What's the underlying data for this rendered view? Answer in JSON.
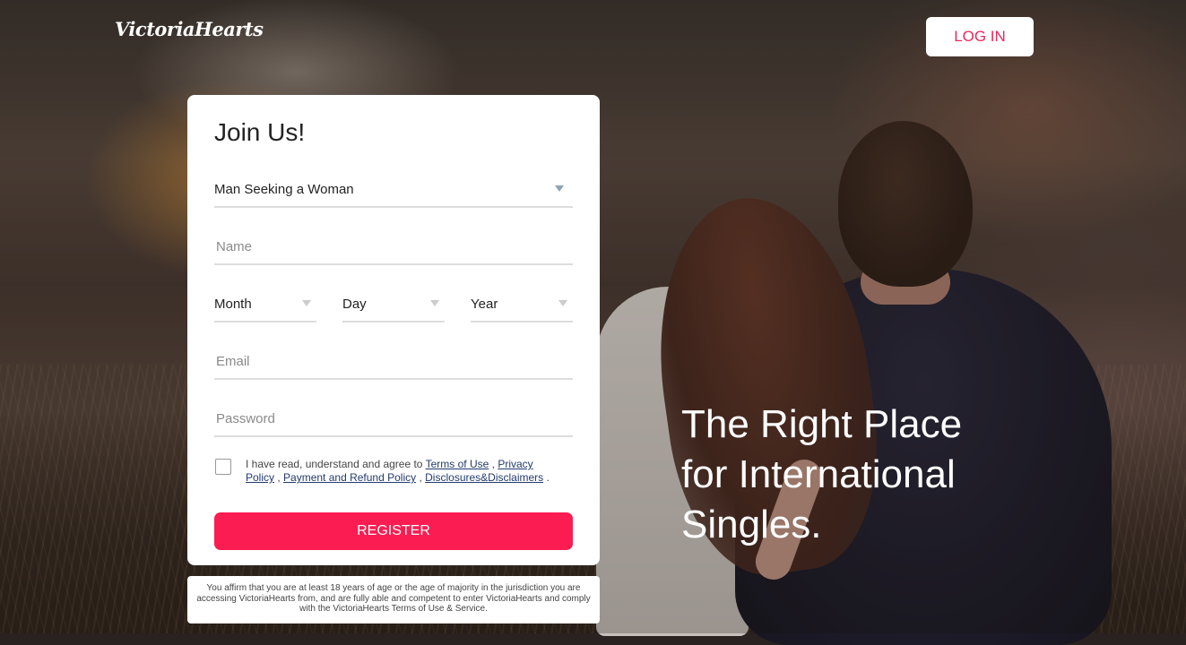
{
  "brand": {
    "logo_text": "VictoriaHearts"
  },
  "header": {
    "login_label": "LOG IN"
  },
  "form": {
    "title": "Join Us!",
    "seeking_value": "Man Seeking a Woman",
    "name_placeholder": "Name",
    "month_label": "Month",
    "day_label": "Day",
    "year_label": "Year",
    "email_placeholder": "Email",
    "password_placeholder": "Password",
    "agree_text": "I have read, understand and agree to",
    "terms_link": "Terms of Use",
    "privacy_link": "Privacy Policy",
    "payment_link": "Payment and Refund Policy",
    "disclosures_link": "Disclosures&Disclaimers",
    "register_label": "REGISTER"
  },
  "disclaimer": "You affirm that you are at least 18 years of age or the age of majority in the jurisdiction you are accessing VictoriaHearts from, and are fully able and competent to enter VictoriaHearts and comply with the VictoriaHearts Terms of Use & Service.",
  "hero": {
    "headline": "The Right Place for International Singles."
  },
  "colors": {
    "accent": "#fb1c51",
    "login_text": "#f0265a",
    "link": "#223b70"
  },
  "icons": {
    "dropdown": "chevron-down-icon"
  }
}
